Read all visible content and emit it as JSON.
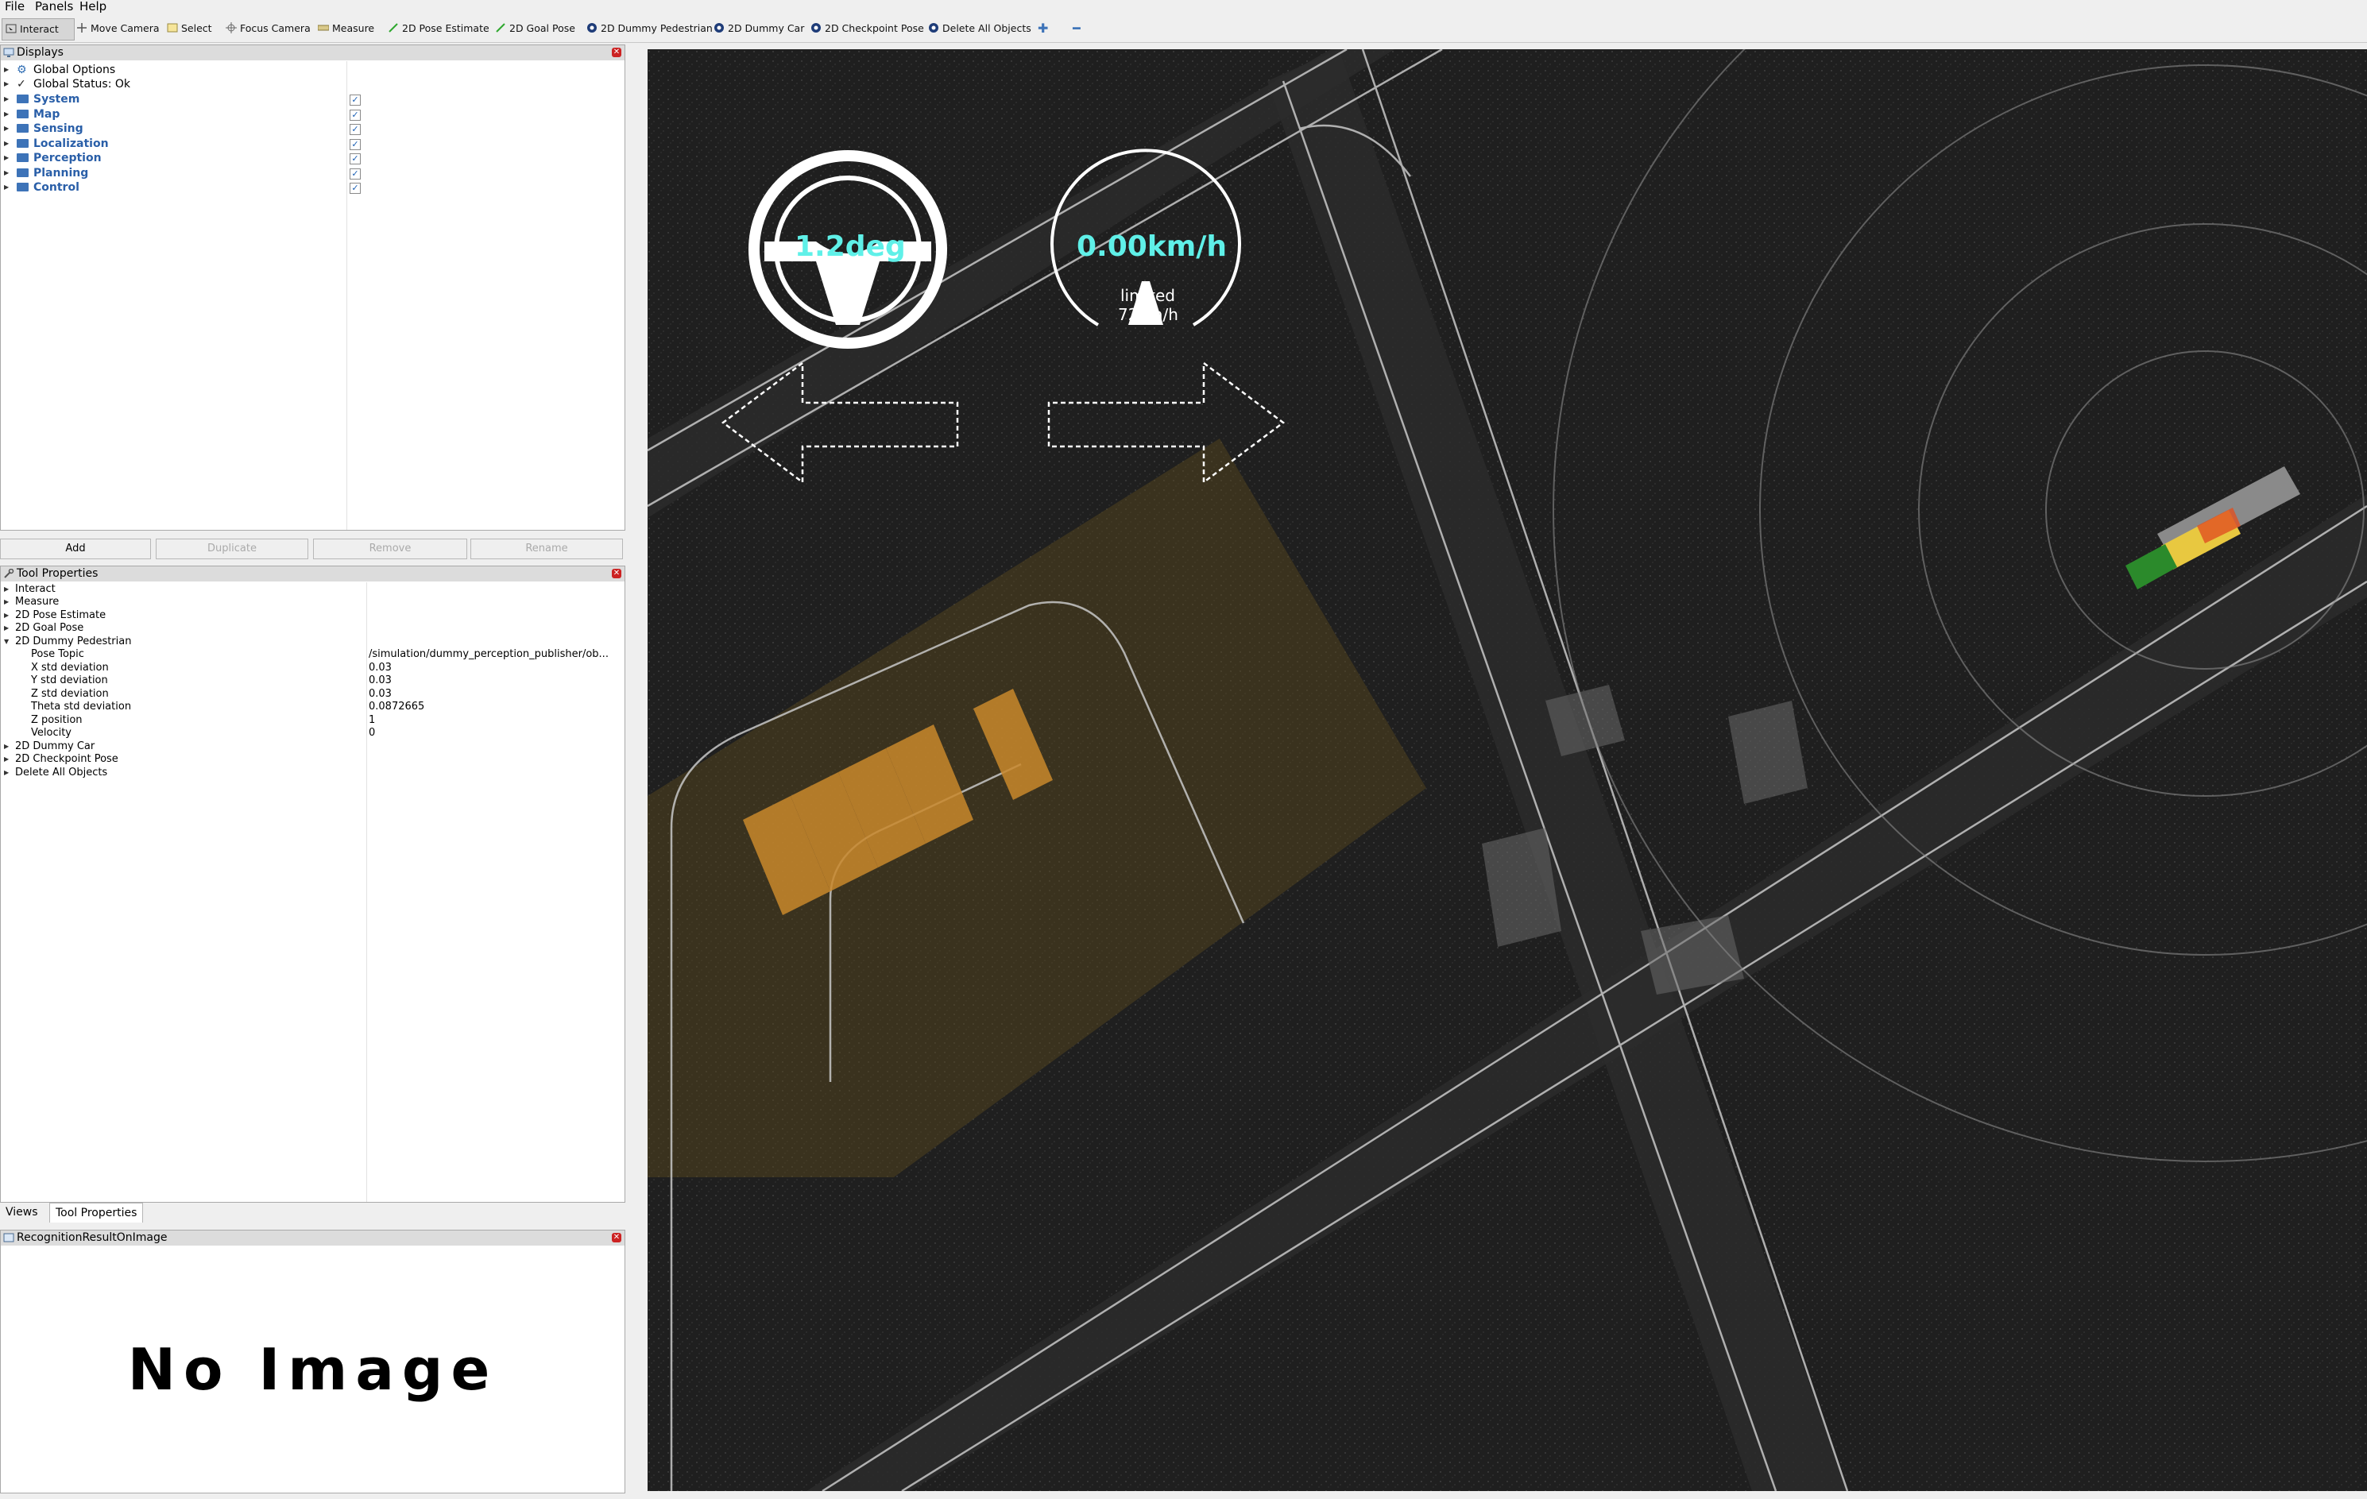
{
  "menu": [
    "File",
    "Panels",
    "Help"
  ],
  "toolbar": [
    {
      "label": "Interact",
      "icon": "interact-icon",
      "active": true
    },
    {
      "label": "Move Camera",
      "icon": "move-camera-icon"
    },
    {
      "label": "Select",
      "icon": "select-icon"
    },
    {
      "label": "Focus Camera",
      "icon": "focus-camera-icon"
    },
    {
      "label": "Measure",
      "icon": "measure-icon"
    },
    {
      "label": "2D Pose Estimate",
      "icon": "pose-estimate-icon"
    },
    {
      "label": "2D Goal Pose",
      "icon": "goal-pose-icon"
    },
    {
      "label": "2D Dummy Pedestrian",
      "icon": "dummy-pedestrian-icon"
    },
    {
      "label": "2D Dummy Car",
      "icon": "dummy-car-icon"
    },
    {
      "label": "2D Checkpoint Pose",
      "icon": "checkpoint-pose-icon"
    },
    {
      "label": "Delete All Objects",
      "icon": "delete-all-icon"
    }
  ],
  "displays": {
    "title": "Displays",
    "items": [
      {
        "label": "Global Options",
        "type": "options"
      },
      {
        "label": "Global Status: Ok",
        "type": "status"
      },
      {
        "label": "System",
        "type": "folder",
        "checked": true
      },
      {
        "label": "Map",
        "type": "folder",
        "checked": true
      },
      {
        "label": "Sensing",
        "type": "folder",
        "checked": true
      },
      {
        "label": "Localization",
        "type": "folder",
        "checked": true
      },
      {
        "label": "Perception",
        "type": "folder",
        "checked": true
      },
      {
        "label": "Planning",
        "type": "folder",
        "checked": true
      },
      {
        "label": "Control",
        "type": "folder",
        "checked": true
      }
    ],
    "buttons": {
      "add": "Add",
      "duplicate": "Duplicate",
      "remove": "Remove",
      "rename": "Rename"
    }
  },
  "tool_properties": {
    "title": "Tool Properties",
    "top_items": [
      "Interact",
      "Measure",
      "2D Pose Estimate",
      "2D Goal Pose",
      "2D Dummy Pedestrian"
    ],
    "pedestrian_props": [
      {
        "name": "Pose Topic",
        "value": "/simulation/dummy_perception_publisher/ob..."
      },
      {
        "name": "X std deviation",
        "value": "0.03"
      },
      {
        "name": "Y std deviation",
        "value": "0.03"
      },
      {
        "name": "Z std deviation",
        "value": "0.03"
      },
      {
        "name": "Theta std deviation",
        "value": "0.0872665"
      },
      {
        "name": "Z position",
        "value": "1"
      },
      {
        "name": "Velocity",
        "value": "0"
      }
    ],
    "bottom_items": [
      "2D Dummy Car",
      "2D Checkpoint Pose",
      "Delete All Objects"
    ]
  },
  "tabs": {
    "views": "Views",
    "tool_properties": "Tool Properties"
  },
  "image_panel": {
    "title": "RecognitionResultOnImage",
    "no_image": "No Image"
  },
  "overlay": {
    "steering": "1.2deg",
    "speed": "0.00km/h",
    "limit_line1": "limited",
    "limit_line2": "72km/h"
  },
  "colors": {
    "hud_cyan": "#5ff0e8",
    "folder_text": "#2a5fa8",
    "orange": "#c9882c"
  }
}
